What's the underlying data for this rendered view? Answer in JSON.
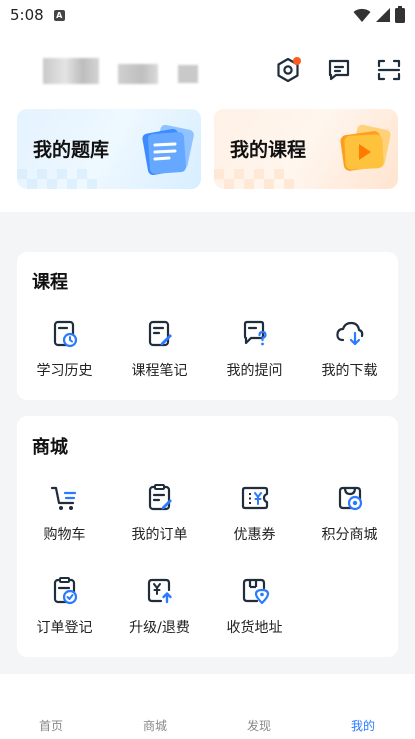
{
  "status_bar": {
    "time": "5:08",
    "sim_label": "A"
  },
  "header": {
    "icons": [
      "settings-icon",
      "message-icon",
      "scan-icon"
    ],
    "notification_dot_color": "#ff5a1f"
  },
  "hero": {
    "question_bank": {
      "label": "我的题库",
      "icon": "document-stack-icon"
    },
    "my_courses": {
      "label": "我的课程",
      "icon": "play-folder-icon"
    }
  },
  "course_section": {
    "title": "课程",
    "items": [
      {
        "label": "学习历史",
        "icon": "history-icon"
      },
      {
        "label": "课程笔记",
        "icon": "notes-icon"
      },
      {
        "label": "我的提问",
        "icon": "question-icon"
      },
      {
        "label": "我的下载",
        "icon": "download-icon"
      }
    ]
  },
  "shop_section": {
    "title": "商城",
    "items": [
      {
        "label": "购物车",
        "icon": "cart-icon"
      },
      {
        "label": "我的订单",
        "icon": "order-icon"
      },
      {
        "label": "优惠券",
        "icon": "coupon-icon"
      },
      {
        "label": "积分商城",
        "icon": "points-store-icon"
      },
      {
        "label": "订单登记",
        "icon": "order-register-icon"
      },
      {
        "label": "升级/退费",
        "icon": "upgrade-refund-icon"
      },
      {
        "label": "收货地址",
        "icon": "address-icon"
      }
    ]
  },
  "tabbar": {
    "tabs": [
      {
        "label": "首页"
      },
      {
        "label": "商城"
      },
      {
        "label": "发现"
      },
      {
        "label": "我的"
      }
    ],
    "active_index": 3
  },
  "colors": {
    "accent": "#2b7bff",
    "icon_dark": "#1f2d3d",
    "icon_blue": "#2b7bff"
  }
}
